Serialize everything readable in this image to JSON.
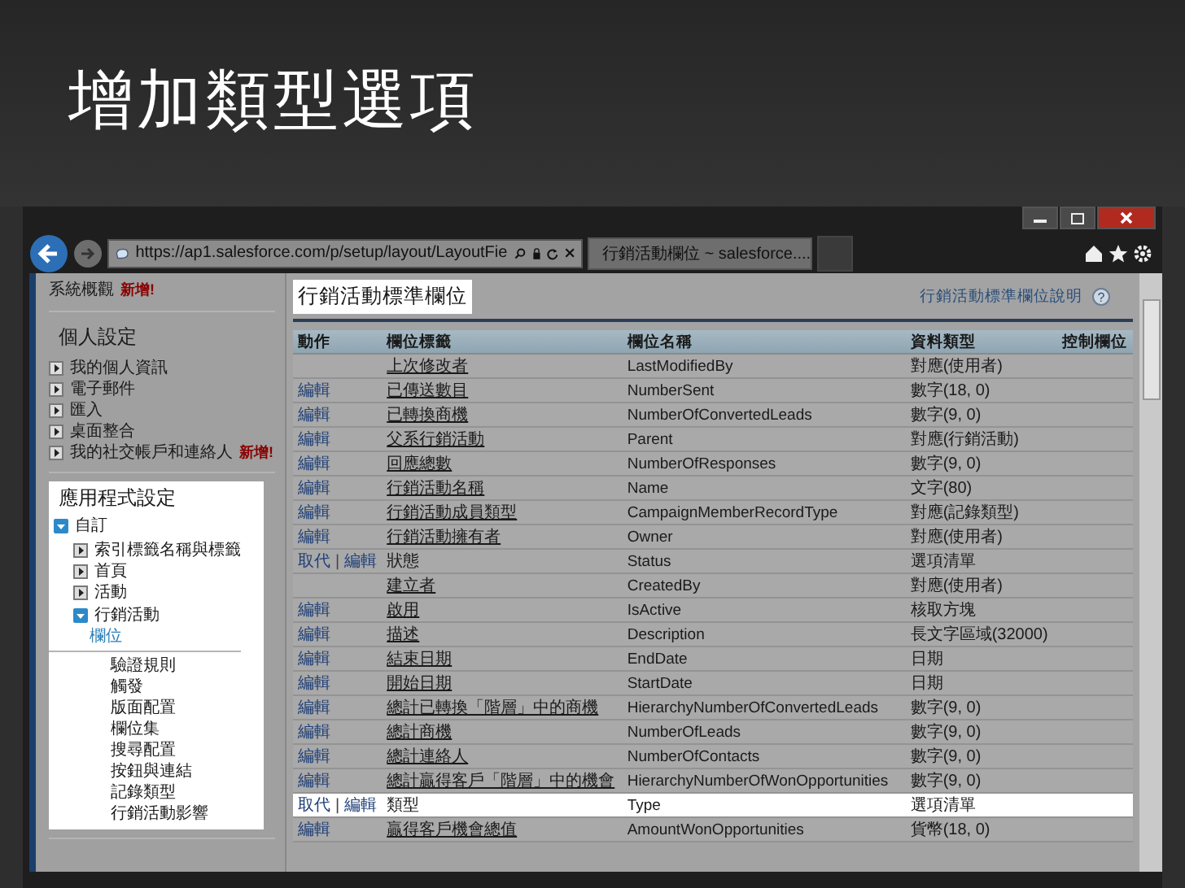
{
  "slide_title": "增加類型選項",
  "browser": {
    "address": "https://ap1.salesforce.com/p/setup/layout/LayoutFie",
    "tab": "行銷活動欄位 ~ salesforce...."
  },
  "sidebar": {
    "overview": {
      "label": "系統概觀",
      "badge": "新增!"
    },
    "sections": [
      {
        "title": "個人設定",
        "highlighted": false,
        "items": [
          {
            "label": "我的個人資訊",
            "expanded": false,
            "highlighted": false
          },
          {
            "label": "電子郵件",
            "expanded": false,
            "highlighted": false
          },
          {
            "label": "匯入",
            "expanded": false,
            "highlighted": false
          },
          {
            "label": "桌面整合",
            "expanded": false,
            "highlighted": false
          },
          {
            "label": "我的社交帳戶和連絡人",
            "expanded": false,
            "highlighted": false,
            "badge": "新增!"
          }
        ]
      },
      {
        "title": "應用程式設定",
        "highlighted": true,
        "items": [
          {
            "label": "自訂",
            "expanded": true,
            "highlighted": true,
            "children": [
              {
                "label": "索引標籤名稱與標籤",
                "expanded": false,
                "highlighted": false
              },
              {
                "label": "首頁",
                "expanded": false,
                "highlighted": false
              },
              {
                "label": "活動",
                "expanded": false,
                "highlighted": false
              },
              {
                "label": "行銷活動",
                "expanded": true,
                "highlighted": true,
                "children": [
                  {
                    "label": "欄位",
                    "selected": true,
                    "highlighted": true
                  },
                  {
                    "label": "驗證規則",
                    "selected": false,
                    "highlighted": false
                  },
                  {
                    "label": "觸發",
                    "selected": false,
                    "highlighted": false
                  },
                  {
                    "label": "版面配置",
                    "selected": false,
                    "highlighted": false
                  },
                  {
                    "label": "欄位集",
                    "selected": false,
                    "highlighted": false
                  },
                  {
                    "label": "搜尋配置",
                    "selected": false,
                    "highlighted": false
                  },
                  {
                    "label": "按鈕與連結",
                    "selected": false,
                    "highlighted": false
                  },
                  {
                    "label": "記錄類型",
                    "selected": false,
                    "highlighted": false
                  },
                  {
                    "label": "行銷活動影響",
                    "selected": false,
                    "highlighted": false
                  }
                ]
              }
            ]
          }
        ]
      }
    ]
  },
  "panel": {
    "title": "行銷活動標準欄位",
    "title_highlighted": true,
    "help_link": "行銷活動標準欄位說明",
    "help_icon": "?",
    "action_separator": "|"
  },
  "table": {
    "columns": [
      "動作",
      "欄位標籤",
      "欄位名稱",
      "資料類型",
      "控制欄位"
    ],
    "rows": [
      {
        "actions": [],
        "label": "上次修改者",
        "linked": true,
        "name": "LastModifiedBy",
        "type": "對應(使用者)",
        "highlighted": false
      },
      {
        "actions": [
          "編輯"
        ],
        "label": "已傳送數目",
        "linked": true,
        "name": "NumberSent",
        "type": "數字(18, 0)",
        "highlighted": false
      },
      {
        "actions": [
          "編輯"
        ],
        "label": "已轉換商機",
        "linked": true,
        "name": "NumberOfConvertedLeads",
        "type": "數字(9, 0)",
        "highlighted": false
      },
      {
        "actions": [
          "編輯"
        ],
        "label": "父系行銷活動",
        "linked": true,
        "name": "Parent",
        "type": "對應(行銷活動)",
        "highlighted": false
      },
      {
        "actions": [
          "編輯"
        ],
        "label": "回應總數",
        "linked": true,
        "name": "NumberOfResponses",
        "type": "數字(9, 0)",
        "highlighted": false
      },
      {
        "actions": [
          "編輯"
        ],
        "label": "行銷活動名稱",
        "linked": true,
        "name": "Name",
        "type": "文字(80)",
        "highlighted": false
      },
      {
        "actions": [
          "編輯"
        ],
        "label": "行銷活動成員類型",
        "linked": true,
        "name": "CampaignMemberRecordType",
        "type": "對應(記錄類型)",
        "highlighted": false
      },
      {
        "actions": [
          "編輯"
        ],
        "label": "行銷活動擁有者",
        "linked": true,
        "name": "Owner",
        "type": "對應(使用者)",
        "highlighted": false
      },
      {
        "actions": [
          "取代",
          "編輯"
        ],
        "label": "狀態",
        "linked": false,
        "name": "Status",
        "type": "選項清單",
        "highlighted": false
      },
      {
        "actions": [],
        "label": "建立者",
        "linked": true,
        "name": "CreatedBy",
        "type": "對應(使用者)",
        "highlighted": false
      },
      {
        "actions": [
          "編輯"
        ],
        "label": "啟用",
        "linked": true,
        "name": "IsActive",
        "type": "核取方塊",
        "highlighted": false
      },
      {
        "actions": [
          "編輯"
        ],
        "label": "描述",
        "linked": true,
        "name": "Description",
        "type": "長文字區域(32000)",
        "highlighted": false
      },
      {
        "actions": [
          "編輯"
        ],
        "label": "結束日期",
        "linked": true,
        "name": "EndDate",
        "type": "日期",
        "highlighted": false
      },
      {
        "actions": [
          "編輯"
        ],
        "label": "開始日期",
        "linked": true,
        "name": "StartDate",
        "type": "日期",
        "highlighted": false
      },
      {
        "actions": [
          "編輯"
        ],
        "label": "總計已轉換「階層」中的商機",
        "linked": true,
        "name": "HierarchyNumberOfConvertedLeads",
        "type": "數字(9, 0)",
        "highlighted": false
      },
      {
        "actions": [
          "編輯"
        ],
        "label": "總計商機",
        "linked": true,
        "name": "NumberOfLeads",
        "type": "數字(9, 0)",
        "highlighted": false
      },
      {
        "actions": [
          "編輯"
        ],
        "label": "總計連絡人",
        "linked": true,
        "name": "NumberOfContacts",
        "type": "數字(9, 0)",
        "highlighted": false
      },
      {
        "actions": [
          "編輯"
        ],
        "label": "總計贏得客戶「階層」中的機會",
        "linked": true,
        "name": "HierarchyNumberOfWonOpportunities",
        "type": "數字(9, 0)",
        "highlighted": false
      },
      {
        "actions": [
          "取代",
          "編輯"
        ],
        "label": "類型",
        "linked": false,
        "name": "Type",
        "type": "選項清單",
        "highlighted": true
      },
      {
        "actions": [
          "編輯"
        ],
        "label": "贏得客戶機會總值",
        "linked": true,
        "name": "AmountWonOpportunities",
        "type": "貨幣(18, 0)",
        "highlighted": false
      }
    ]
  }
}
